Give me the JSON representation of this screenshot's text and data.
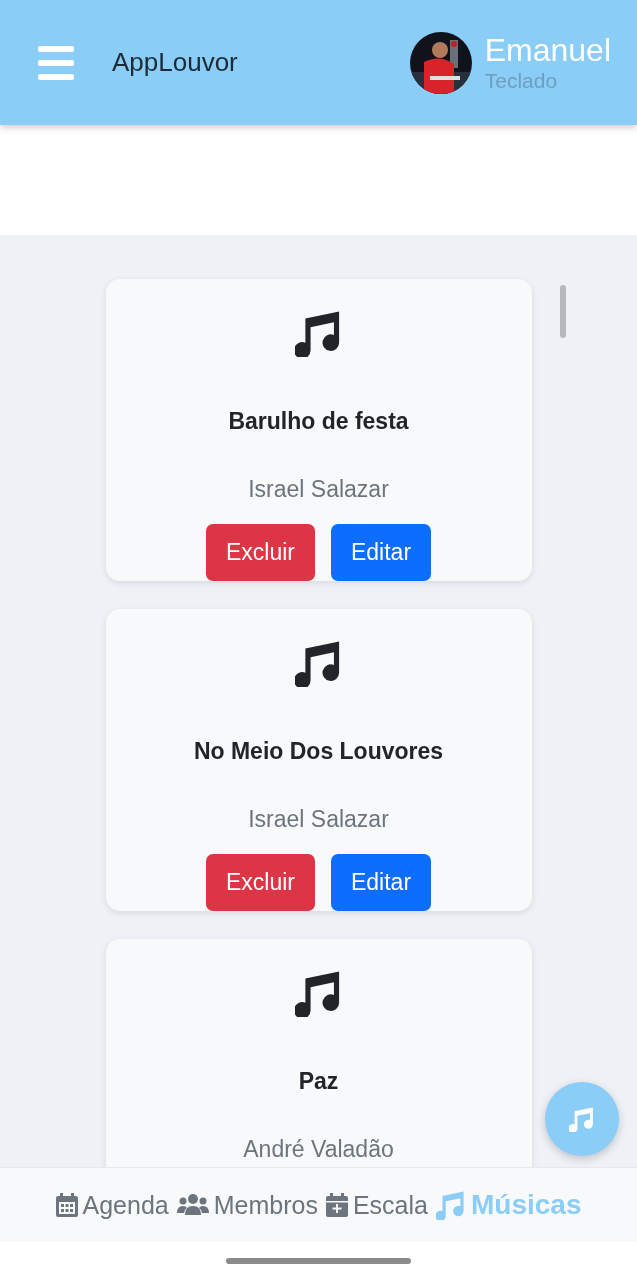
{
  "header": {
    "title": "AppLouvor",
    "user": {
      "name": "Emanuel",
      "role": "Teclado"
    }
  },
  "songs": [
    {
      "title": "Barulho de festa",
      "artist": "Israel Salazar",
      "actions": [
        {
          "label": "Excluir",
          "kind": "danger"
        },
        {
          "label": "Editar",
          "kind": "primary"
        }
      ]
    },
    {
      "title": "No Meio Dos Louvores",
      "artist": "Israel Salazar",
      "actions": [
        {
          "label": "Excluir",
          "kind": "danger"
        },
        {
          "label": "Editar",
          "kind": "primary"
        }
      ]
    },
    {
      "title": "Paz",
      "artist": "André Valadão"
    }
  ],
  "bottom_nav": [
    {
      "label": "Agenda",
      "selected": false
    },
    {
      "label": "Membros",
      "selected": false
    },
    {
      "label": "Escala",
      "selected": false
    },
    {
      "label": "Músicas",
      "selected": true
    }
  ]
}
